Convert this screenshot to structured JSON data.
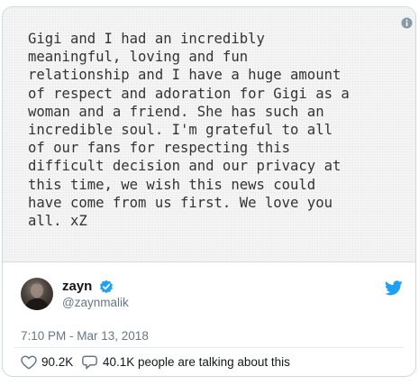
{
  "note": {
    "text": "Gigi and I had an incredibly\nmeaningful, loving and fun\nrelationship and I have a huge amount\nof respect and adoration for Gigi as a\nwoman and a friend. She has such an\nincredible soul. I'm grateful to all\nof our fans for respecting this\ndifficult decision and our privacy at\nthis time, we wish this news could\nhave come from us first. We love you\nall. xZ"
  },
  "author": {
    "display_name": "zayn",
    "handle": "@zaynmalik",
    "verified": true
  },
  "tweet": {
    "timestamp": "7:10 PM - Mar 13, 2018",
    "likes": "90.2K",
    "talking": "40.1K people are talking about this"
  },
  "icons": {
    "info": "info-icon",
    "verified": "verified-badge-icon",
    "twitter": "twitter-bird-icon",
    "like": "heart-icon",
    "reply": "speech-bubble-icon"
  },
  "colors": {
    "twitter_blue": "#1da1f2",
    "secondary_text": "#657786",
    "primary_text": "#14171a"
  }
}
